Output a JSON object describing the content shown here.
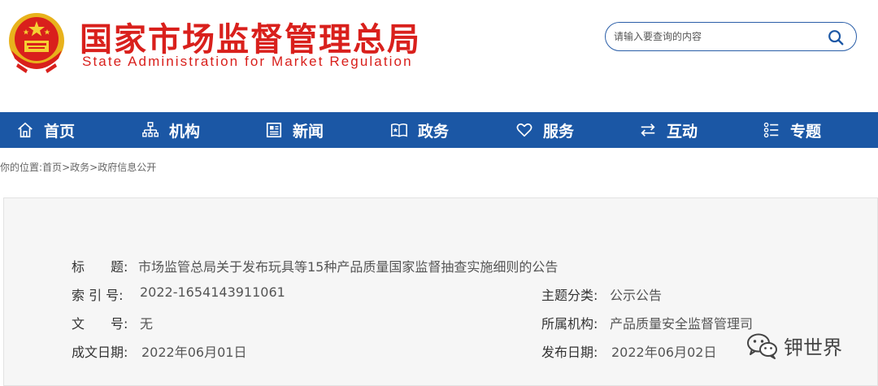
{
  "header": {
    "title_cn": "国家市场监督管理总局",
    "title_en": "State Administration for Market Regulation",
    "search_placeholder": "请输入要查询的内容"
  },
  "nav": {
    "items": [
      {
        "label": "首页",
        "icon": "home-icon"
      },
      {
        "label": "机构",
        "icon": "org-chart-icon"
      },
      {
        "label": "新闻",
        "icon": "newspaper-icon"
      },
      {
        "label": "政务",
        "icon": "book-icon"
      },
      {
        "label": "服务",
        "icon": "heart-icon"
      },
      {
        "label": "互动",
        "icon": "exchange-arrows-icon"
      },
      {
        "label": "专题",
        "icon": "list-icon"
      }
    ]
  },
  "breadcrumb": {
    "prefix": "你的位置:",
    "items": [
      "首页",
      "政务",
      "政府信息公开"
    ],
    "separator": ">"
  },
  "info": {
    "title_label": "标　　题:",
    "title_value": "市场监管总局关于发布玩具等15种产品质量国家监督抽查实施细则的公告",
    "index_label": "索 引 号:",
    "index_value": "2022-1654143911061",
    "category_label": "主题分类:",
    "category_value": "公示公告",
    "doc_no_label": "文　　号:",
    "doc_no_value": "无",
    "agency_label": "所属机构:",
    "agency_value": "产品质量安全监督管理司",
    "created_label": "成文日期:",
    "created_value": "2022年06月01日",
    "published_label": "发布日期:",
    "published_value": "2022年06月02日"
  },
  "watermark": {
    "text": "钾世界",
    "icon": "wechat-icon"
  },
  "colors": {
    "brand_red": "#d9201c",
    "nav_blue": "#1b57a5",
    "panel_bg": "#f6f6f6"
  }
}
